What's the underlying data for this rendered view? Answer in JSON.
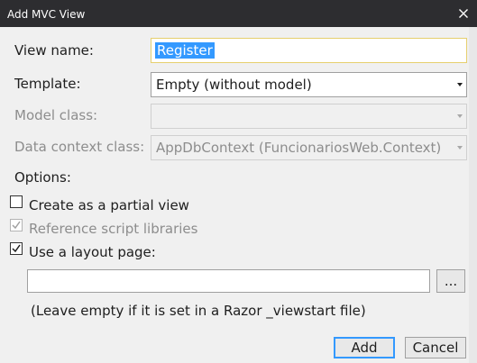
{
  "window": {
    "title": "Add MVC View"
  },
  "form": {
    "view_name": {
      "label": "View name:",
      "value": "Register"
    },
    "template": {
      "label": "Template:",
      "value": "Empty (without model)"
    },
    "model_class": {
      "label": "Model class:",
      "value": ""
    },
    "data_context": {
      "label": "Data context class:",
      "value": "AppDbContext (FuncionariosWeb.Context)"
    }
  },
  "options": {
    "heading": "Options:",
    "partial_view": {
      "label": "Create as a partial view",
      "checked": false
    },
    "reference_scripts": {
      "label": "Reference script libraries",
      "checked": true,
      "disabled": true
    },
    "layout_page": {
      "label": "Use a layout page:",
      "checked": true
    },
    "layout_path": {
      "value": "",
      "browse_label": "..."
    },
    "hint": "(Leave empty if it is set in a Razor _viewstart file)"
  },
  "buttons": {
    "add": "Add",
    "cancel": "Cancel"
  },
  "colors": {
    "titlebar": "#2d2d30",
    "dialog": "#f0f0f0",
    "selection": "#3399ff",
    "focus_border": "#e6cf6e"
  }
}
